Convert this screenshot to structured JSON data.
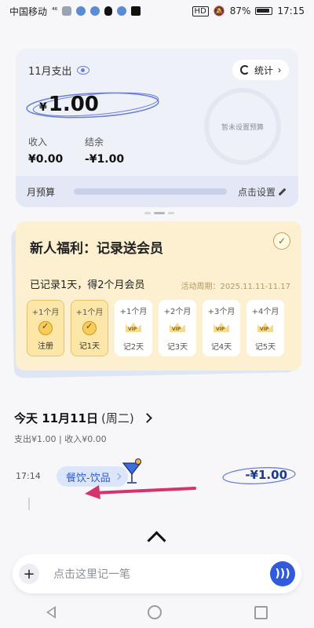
{
  "status_bar": {
    "carrier": "中国移动",
    "network": "⁴⁶",
    "battery": "87%",
    "time": "17:15",
    "hd": "HD"
  },
  "summary": {
    "month_label": "11月支出",
    "stats_button": "统计",
    "currency": "¥",
    "amount": "1.00",
    "income_label": "收入",
    "income_value": "¥0.00",
    "balance_label": "结余",
    "balance_value": "-¥1.00",
    "budget_ring_text": "暂未设置预算",
    "budget_label": "月预算",
    "budget_action": "点击设置"
  },
  "promo": {
    "title": "新人福利：记录送会员",
    "subtitle": "已记录1天，得2个月会员",
    "period": "活动周期：2025.11.11-11.17",
    "rewards": [
      {
        "top": "+1个月",
        "bottom": "注册",
        "done": true
      },
      {
        "top": "+1个月",
        "bottom": "记1天",
        "done": true
      },
      {
        "top": "+1个月",
        "bottom": "记2天",
        "done": false
      },
      {
        "top": "+2个月",
        "bottom": "记3天",
        "done": false
      },
      {
        "top": "+3个月",
        "bottom": "记4天",
        "done": false
      },
      {
        "top": "+4个月",
        "bottom": "记5天",
        "done": false
      }
    ],
    "vip": "VIP"
  },
  "day": {
    "title": "今天 11月11日",
    "weekday": "(周二)",
    "summary": "支出¥1.00 | 收入¥0.00"
  },
  "entry": {
    "time": "17:14",
    "category": "餐饮-饮品",
    "amount": "-¥1.00"
  },
  "composer": {
    "placeholder": "点击这里记一笔",
    "plus": "+"
  },
  "colors": {
    "accent": "#2f5bdc",
    "promo_bg": "#fcf0d1",
    "arrow": "#d6336c"
  }
}
